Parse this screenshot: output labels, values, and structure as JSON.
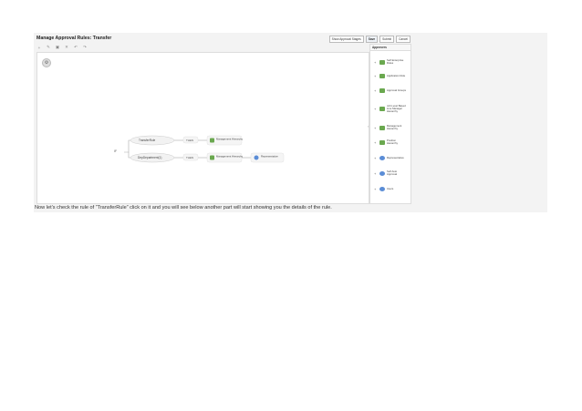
{
  "window": {
    "title": "Manage Approval Rules: Transfer"
  },
  "top_buttons": [
    {
      "label": "Show Approval Stages"
    },
    {
      "label": "Save"
    },
    {
      "label": "Submit"
    },
    {
      "label": "Cancel"
    }
  ],
  "toolbar": {
    "icons": [
      "add-icon",
      "edit-icon",
      "copy-icon",
      "delete-icon",
      "undo-icon",
      "redo-icon"
    ]
  },
  "flow": {
    "start_label": "IF",
    "rules": [
      {
        "name": "TransferRule",
        "then": "THEN",
        "action": "Management Hierarchy"
      },
      {
        "name": "DepDepartment(1)",
        "then": "THEN",
        "action": "Management Hierarchy",
        "extra": "Representative"
      }
    ]
  },
  "panel": {
    "title": "Approvers",
    "items": [
      {
        "label": "Self Enterprise Rules",
        "icon": "green"
      },
      {
        "label": "Application Role",
        "icon": "green"
      },
      {
        "label": "Approval Groups",
        "icon": "green"
      },
      {
        "label": "Job Level Based Line Manager Hierarchy",
        "icon": "green"
      },
      {
        "label": "Management Hierarchy",
        "icon": "green"
      },
      {
        "label": "Position Hierarchy",
        "icon": "green"
      },
      {
        "label": "Representative",
        "icon": "blue"
      },
      {
        "label": "Self Auto Approval",
        "icon": "blue"
      },
      {
        "label": "Users",
        "icon": "blue"
      }
    ]
  },
  "caption": "Now let’s check the rule of “TransferRule” click on it and you will see below another part will start showing you the details of the rule."
}
